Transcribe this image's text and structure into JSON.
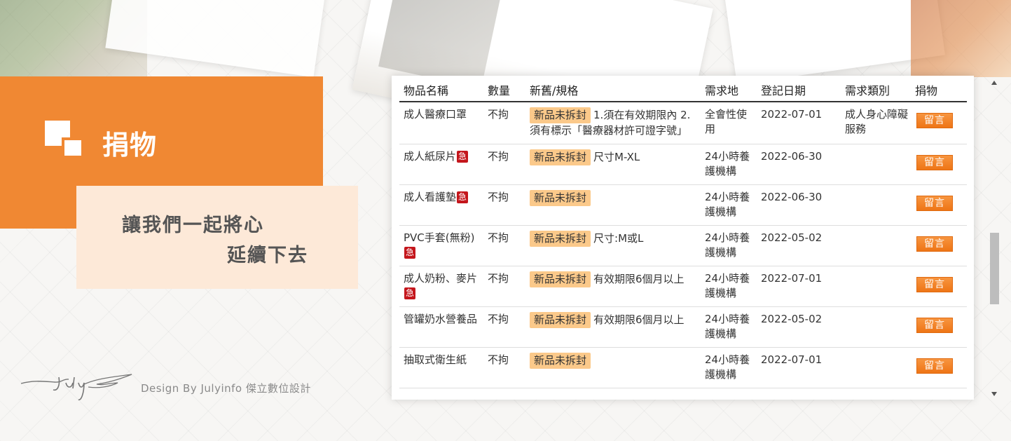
{
  "page": {
    "title": "捐物",
    "slogan_line1": "讓我們一起將心",
    "slogan_line2": "延續下去",
    "credit": "Design By Julyinfo 傑立數位設計"
  },
  "colors": {
    "accent": "#f08833",
    "peach": "#fde9d8",
    "badge_condition": "#fbc98a",
    "badge_urgent": "#c4161c",
    "button": "#f07e22"
  },
  "table": {
    "headers": [
      "物品名稱",
      "數量",
      "新舊/規格",
      "需求地",
      "登記日期",
      "需求類別",
      "捐物"
    ],
    "rows": [
      {
        "name": "成人醫療口罩",
        "urgent": "",
        "qty": "不拘",
        "condition": "新品未拆封",
        "spec": "1.須在有效期限內 2.須有標示「醫療器材許可證字號」",
        "location": "全會性使用",
        "date": "2022-07-01",
        "category": "成人身心障礙服務",
        "action": "留言"
      },
      {
        "name": "成人紙尿片",
        "urgent": "急",
        "qty": "不拘",
        "condition": "新品未拆封",
        "spec": "尺寸M-XL",
        "location": "24小時養護機構",
        "date": "2022-06-30",
        "category": "",
        "action": "留言"
      },
      {
        "name": "成人看護墊",
        "urgent": "急",
        "qty": "不拘",
        "condition": "新品未拆封",
        "spec": "",
        "location": "24小時養護機構",
        "date": "2022-06-30",
        "category": "",
        "action": "留言"
      },
      {
        "name": "PVC手套(無粉)",
        "urgent": "急",
        "qty": "不拘",
        "condition": "新品未拆封",
        "spec": "尺寸:M或L",
        "location": "24小時養護機構",
        "date": "2022-05-02",
        "category": "",
        "action": "留言"
      },
      {
        "name": "成人奶粉、麥片",
        "urgent": "急",
        "qty": "不拘",
        "condition": "新品未拆封",
        "spec": "有效期限6個月以上",
        "location": "24小時養護機構",
        "date": "2022-07-01",
        "category": "",
        "action": "留言"
      },
      {
        "name": "管罐奶水營養品",
        "urgent": "",
        "qty": "不拘",
        "condition": "新品未拆封",
        "spec": "有效期限6個月以上",
        "location": "24小時養護機構",
        "date": "2022-05-02",
        "category": "",
        "action": "留言"
      },
      {
        "name": "抽取式衛生紙",
        "urgent": "",
        "qty": "不拘",
        "condition": "新品未拆封",
        "spec": "",
        "location": "24小時養護機構",
        "date": "2022-07-01",
        "category": "",
        "action": "留言"
      }
    ]
  },
  "icons": {
    "logo": "squares-logo-icon",
    "signature": "july-signature",
    "scroll_up": "scroll-up-arrow-icon",
    "scroll_down": "scroll-down-arrow-icon"
  }
}
